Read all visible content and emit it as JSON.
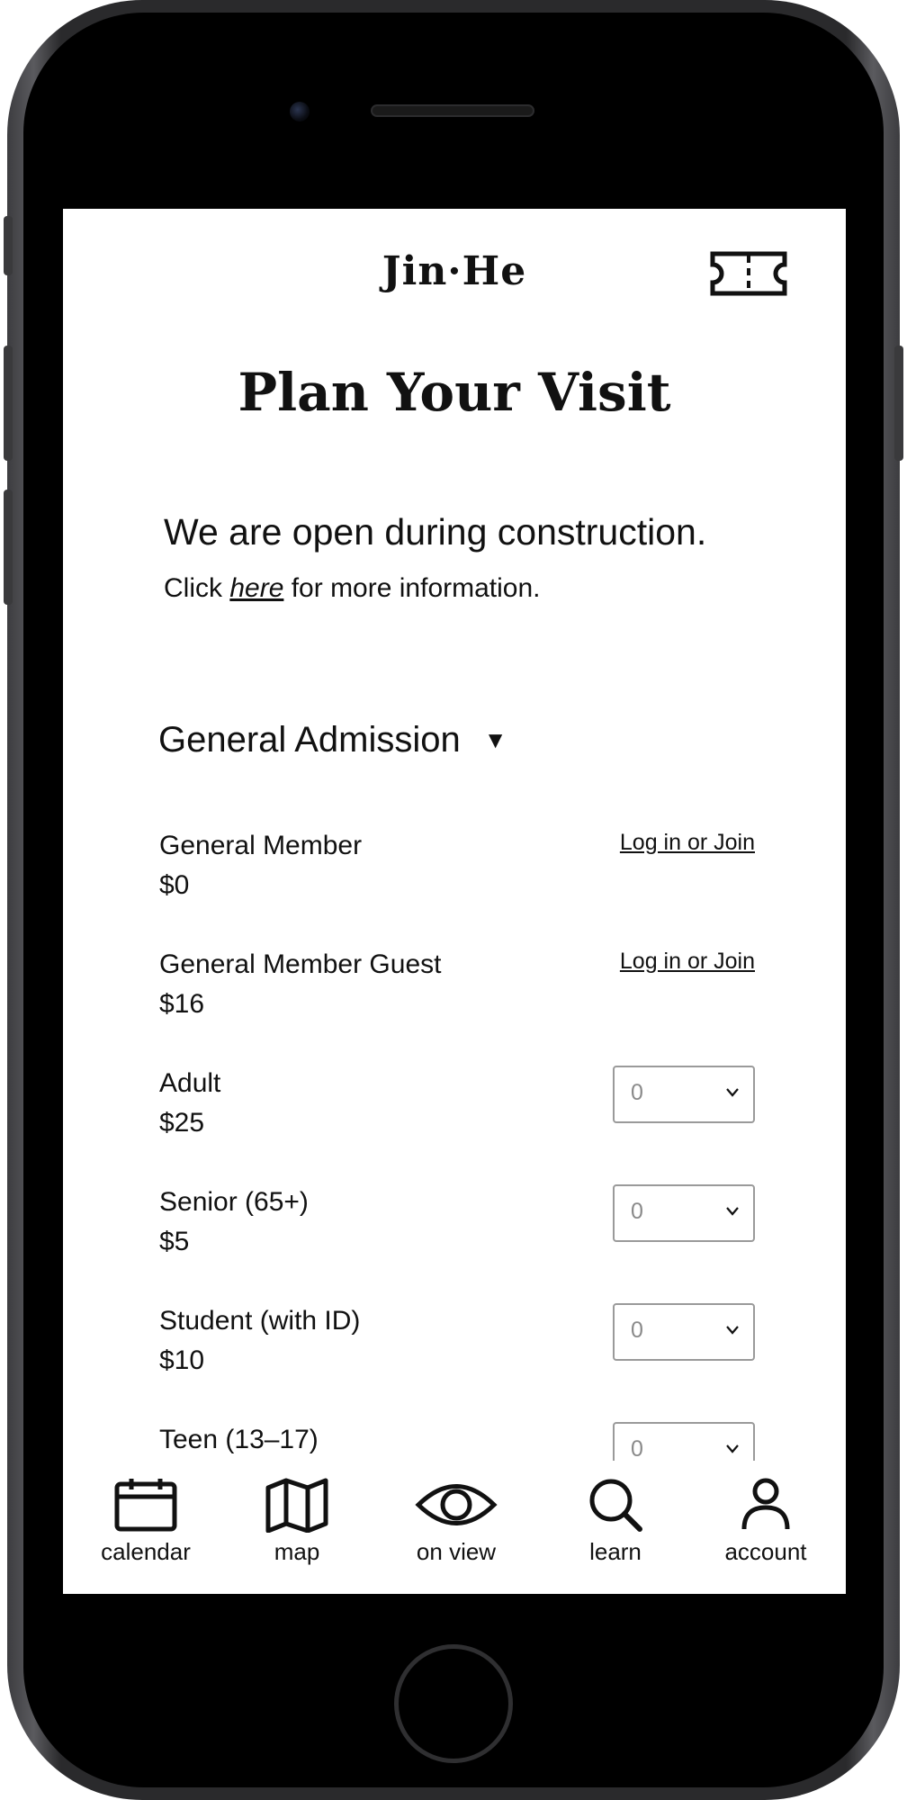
{
  "app": {
    "logo": "Jin·He"
  },
  "page": {
    "title": "Plan Your Visit"
  },
  "notice": {
    "headline": "We are open during construction.",
    "prefix": "Click ",
    "link": "here",
    "suffix": " for more information."
  },
  "admission": {
    "heading": "General Admission",
    "tickets": [
      {
        "name": "General Member",
        "price": "$0",
        "action": "Log in or Join"
      },
      {
        "name": "General Member Guest",
        "price": "$16",
        "action": "Log in or Join"
      },
      {
        "name": "Adult",
        "price": "$25",
        "quantity": "0"
      },
      {
        "name": "Senior (65+)",
        "price": "$5",
        "quantity": "0"
      },
      {
        "name": "Student (with ID)",
        "price": "$10",
        "quantity": "0"
      },
      {
        "name": "Teen (13–17)",
        "quantity": "0"
      }
    ]
  },
  "nav": {
    "items": [
      {
        "label": "calendar",
        "icon": "calendar-icon"
      },
      {
        "label": "map",
        "icon": "map-icon"
      },
      {
        "label": "on view",
        "icon": "eye-icon"
      },
      {
        "label": "learn",
        "icon": "search-icon"
      },
      {
        "label": "account",
        "icon": "account-icon"
      }
    ]
  }
}
